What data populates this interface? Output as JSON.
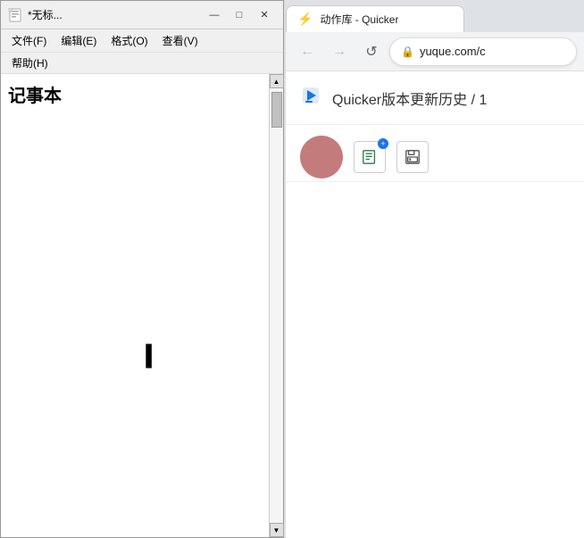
{
  "notepad": {
    "title": "*无标...",
    "icon": "📄",
    "menu": {
      "file": "文件(F)",
      "edit": "编辑(E)",
      "format": "格式(O)",
      "view": "查看(V)",
      "help": "帮助(H)"
    },
    "label": "记事本",
    "content": "",
    "titlebar_buttons": {
      "minimize": "—",
      "maximize": "□",
      "close": "✕"
    }
  },
  "browser": {
    "tab_title": "动作库 - Quicker",
    "address": "yuque.com/c",
    "page_title": "Quicker版本更新历史 / 1",
    "back_btn": "←",
    "forward_btn": "→",
    "reload_btn": "↺",
    "lock_icon": "🔒",
    "lightning_icon": "⚡",
    "add_icon": "+",
    "save_icon": "💾"
  }
}
